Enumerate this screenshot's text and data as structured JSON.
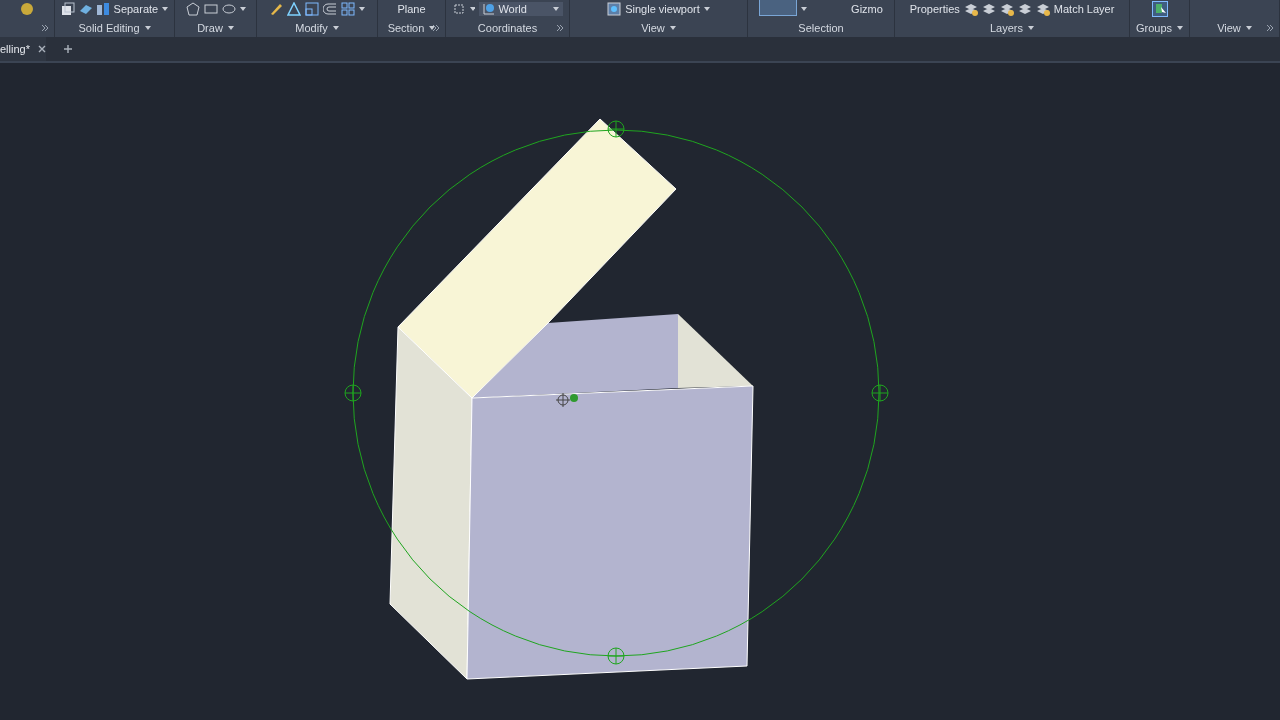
{
  "ribbon": {
    "panels": [
      {
        "menu": false,
        "expander": true
      },
      {
        "title": "Solid Editing",
        "menu": true,
        "expander": false,
        "tools": [
          "Separate"
        ]
      },
      {
        "title": "Draw",
        "menu": true,
        "expander": false
      },
      {
        "title": "Modify",
        "menu": true,
        "expander": false
      },
      {
        "title": "Section",
        "menu": true,
        "expander": true,
        "tools": [
          "Plane"
        ]
      },
      {
        "title": "Coordinates",
        "menu": false,
        "expander": true,
        "tools": [
          "World"
        ]
      },
      {
        "title": "View",
        "menu": true,
        "expander": false,
        "tools": [
          "Single viewport"
        ]
      },
      {
        "title": "Selection",
        "menu": false,
        "expander": false,
        "tools": [
          "Gizmo"
        ]
      },
      {
        "title": "Layers",
        "menu": true,
        "expander": false,
        "tools": [
          "Properties",
          "Match Layer"
        ]
      },
      {
        "title": "Groups",
        "menu": true,
        "expander": false
      },
      {
        "title": "View",
        "menu": true,
        "expander": true
      }
    ]
  },
  "tabs": [
    {
      "label": "elling*",
      "selected": true
    }
  ]
}
